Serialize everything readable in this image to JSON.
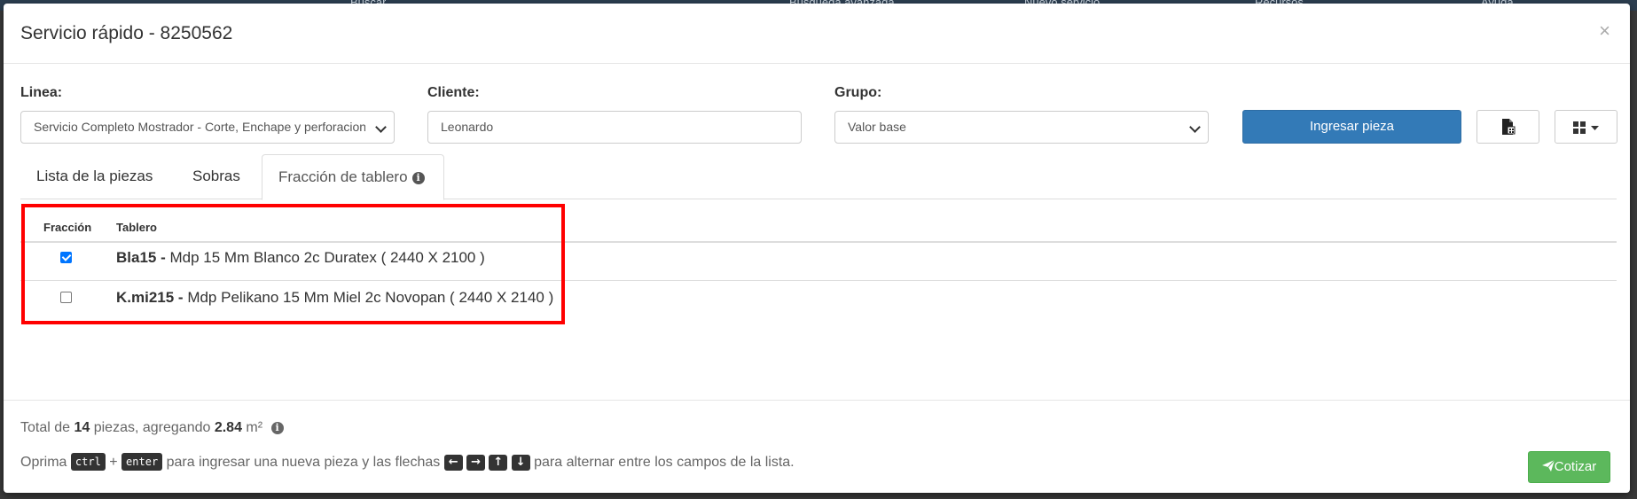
{
  "backdrop": {
    "search_placeholder": "Buscar",
    "advanced_search": "Búsqueda avanzada",
    "new_service": "Nuevo servicio",
    "resources": "Recursos",
    "help": "Ayuda"
  },
  "modal": {
    "title": "Servicio rápido - 8250562",
    "close": "×"
  },
  "form": {
    "linea_label": "Linea:",
    "linea_value": "Servicio Completo Mostrador - Corte, Enchape y perforacion",
    "cliente_label": "Cliente:",
    "cliente_value": "Leonardo",
    "grupo_label": "Grupo:",
    "grupo_value": "Valor base",
    "ingresar_label": "Ingresar pieza"
  },
  "tabs": [
    {
      "label": "Lista de la piezas"
    },
    {
      "label": "Sobras"
    },
    {
      "label": "Fracción de tablero"
    }
  ],
  "table": {
    "headers": {
      "fraccion": "Fracción",
      "tablero": "Tablero"
    },
    "rows": [
      {
        "checked": true,
        "code": "Bla15",
        "sep": " - ",
        "desc": "Mdp 15 Mm Blanco 2c Duratex ( 2440 X 2100 )"
      },
      {
        "checked": false,
        "code": "K.mi215",
        "sep": " - ",
        "desc": "Mdp Pelikano 15 Mm Miel 2c Novopan ( 2440 X 2140 )"
      }
    ]
  },
  "footer": {
    "total_prefix": "Total de ",
    "total_count": "14",
    "total_mid": " piezas, agregando ",
    "total_area": "2.84",
    "total_unit": " m²",
    "hint_prefix": "Oprima ",
    "key_ctrl": "ctrl",
    "plus": " + ",
    "key_enter": "enter",
    "hint_mid": " para ingresar una nueva pieza y las flechas ",
    "arrow_left": "←",
    "arrow_right": "→",
    "arrow_up": "↑",
    "arrow_down": "↓",
    "hint_suffix": " para alternar entre los campos de la lista.",
    "cotizar_label": "Cotizar"
  },
  "colors": {
    "primary": "#337ab7",
    "success": "#5cb85c",
    "highlight": "#ff0000"
  }
}
